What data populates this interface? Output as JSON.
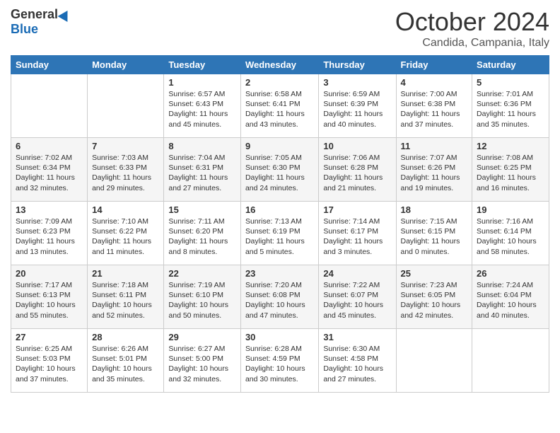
{
  "header": {
    "logo_general": "General",
    "logo_blue": "Blue",
    "month_title": "October 2024",
    "subtitle": "Candida, Campania, Italy"
  },
  "days_of_week": [
    "Sunday",
    "Monday",
    "Tuesday",
    "Wednesday",
    "Thursday",
    "Friday",
    "Saturday"
  ],
  "weeks": [
    [
      {
        "day": "",
        "content": ""
      },
      {
        "day": "",
        "content": ""
      },
      {
        "day": "1",
        "content": "Sunrise: 6:57 AM\nSunset: 6:43 PM\nDaylight: 11 hours and 45 minutes."
      },
      {
        "day": "2",
        "content": "Sunrise: 6:58 AM\nSunset: 6:41 PM\nDaylight: 11 hours and 43 minutes."
      },
      {
        "day": "3",
        "content": "Sunrise: 6:59 AM\nSunset: 6:39 PM\nDaylight: 11 hours and 40 minutes."
      },
      {
        "day": "4",
        "content": "Sunrise: 7:00 AM\nSunset: 6:38 PM\nDaylight: 11 hours and 37 minutes."
      },
      {
        "day": "5",
        "content": "Sunrise: 7:01 AM\nSunset: 6:36 PM\nDaylight: 11 hours and 35 minutes."
      }
    ],
    [
      {
        "day": "6",
        "content": "Sunrise: 7:02 AM\nSunset: 6:34 PM\nDaylight: 11 hours and 32 minutes."
      },
      {
        "day": "7",
        "content": "Sunrise: 7:03 AM\nSunset: 6:33 PM\nDaylight: 11 hours and 29 minutes."
      },
      {
        "day": "8",
        "content": "Sunrise: 7:04 AM\nSunset: 6:31 PM\nDaylight: 11 hours and 27 minutes."
      },
      {
        "day": "9",
        "content": "Sunrise: 7:05 AM\nSunset: 6:30 PM\nDaylight: 11 hours and 24 minutes."
      },
      {
        "day": "10",
        "content": "Sunrise: 7:06 AM\nSunset: 6:28 PM\nDaylight: 11 hours and 21 minutes."
      },
      {
        "day": "11",
        "content": "Sunrise: 7:07 AM\nSunset: 6:26 PM\nDaylight: 11 hours and 19 minutes."
      },
      {
        "day": "12",
        "content": "Sunrise: 7:08 AM\nSunset: 6:25 PM\nDaylight: 11 hours and 16 minutes."
      }
    ],
    [
      {
        "day": "13",
        "content": "Sunrise: 7:09 AM\nSunset: 6:23 PM\nDaylight: 11 hours and 13 minutes."
      },
      {
        "day": "14",
        "content": "Sunrise: 7:10 AM\nSunset: 6:22 PM\nDaylight: 11 hours and 11 minutes."
      },
      {
        "day": "15",
        "content": "Sunrise: 7:11 AM\nSunset: 6:20 PM\nDaylight: 11 hours and 8 minutes."
      },
      {
        "day": "16",
        "content": "Sunrise: 7:13 AM\nSunset: 6:19 PM\nDaylight: 11 hours and 5 minutes."
      },
      {
        "day": "17",
        "content": "Sunrise: 7:14 AM\nSunset: 6:17 PM\nDaylight: 11 hours and 3 minutes."
      },
      {
        "day": "18",
        "content": "Sunrise: 7:15 AM\nSunset: 6:15 PM\nDaylight: 11 hours and 0 minutes."
      },
      {
        "day": "19",
        "content": "Sunrise: 7:16 AM\nSunset: 6:14 PM\nDaylight: 10 hours and 58 minutes."
      }
    ],
    [
      {
        "day": "20",
        "content": "Sunrise: 7:17 AM\nSunset: 6:13 PM\nDaylight: 10 hours and 55 minutes."
      },
      {
        "day": "21",
        "content": "Sunrise: 7:18 AM\nSunset: 6:11 PM\nDaylight: 10 hours and 52 minutes."
      },
      {
        "day": "22",
        "content": "Sunrise: 7:19 AM\nSunset: 6:10 PM\nDaylight: 10 hours and 50 minutes."
      },
      {
        "day": "23",
        "content": "Sunrise: 7:20 AM\nSunset: 6:08 PM\nDaylight: 10 hours and 47 minutes."
      },
      {
        "day": "24",
        "content": "Sunrise: 7:22 AM\nSunset: 6:07 PM\nDaylight: 10 hours and 45 minutes."
      },
      {
        "day": "25",
        "content": "Sunrise: 7:23 AM\nSunset: 6:05 PM\nDaylight: 10 hours and 42 minutes."
      },
      {
        "day": "26",
        "content": "Sunrise: 7:24 AM\nSunset: 6:04 PM\nDaylight: 10 hours and 40 minutes."
      }
    ],
    [
      {
        "day": "27",
        "content": "Sunrise: 6:25 AM\nSunset: 5:03 PM\nDaylight: 10 hours and 37 minutes."
      },
      {
        "day": "28",
        "content": "Sunrise: 6:26 AM\nSunset: 5:01 PM\nDaylight: 10 hours and 35 minutes."
      },
      {
        "day": "29",
        "content": "Sunrise: 6:27 AM\nSunset: 5:00 PM\nDaylight: 10 hours and 32 minutes."
      },
      {
        "day": "30",
        "content": "Sunrise: 6:28 AM\nSunset: 4:59 PM\nDaylight: 10 hours and 30 minutes."
      },
      {
        "day": "31",
        "content": "Sunrise: 6:30 AM\nSunset: 4:58 PM\nDaylight: 10 hours and 27 minutes."
      },
      {
        "day": "",
        "content": ""
      },
      {
        "day": "",
        "content": ""
      }
    ]
  ]
}
